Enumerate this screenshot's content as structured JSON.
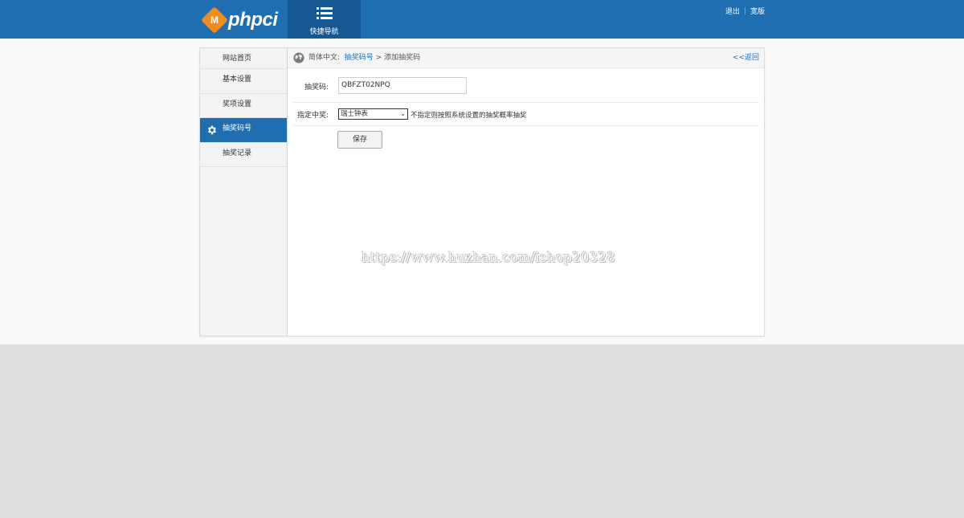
{
  "header": {
    "logo_badge": "M",
    "logo_text": "phpci",
    "quicknav_label": "快捷导航",
    "links": [
      "退出",
      "宽版"
    ]
  },
  "sidebar": {
    "items": [
      {
        "label": "网站首页",
        "active": false
      },
      {
        "label": "基本设置",
        "active": false
      },
      {
        "label": "奖项设置",
        "active": false
      },
      {
        "label": "抽奖码号",
        "active": true
      },
      {
        "label": "抽奖记录",
        "active": false
      }
    ]
  },
  "breadcrumb": {
    "prefix": "简体中文:",
    "link": "抽奖码号",
    "separator": ">",
    "current": "添加抽奖码",
    "back": "<<返回"
  },
  "form": {
    "code_label": "抽奖码:",
    "code_value": "QBFZT02NPQ",
    "prize_label": "指定中奖:",
    "prize_selected": "瑞士钟表",
    "prize_hint": "不指定则按照系统设置的抽奖概率抽奖",
    "save_label": "保存"
  },
  "watermark": "https://www.huzhan.com/ishop20328",
  "colors": {
    "brand_blue": "#1e6eb1",
    "quicknav_blue": "#155893",
    "logo_orange": "#f08c1e"
  }
}
